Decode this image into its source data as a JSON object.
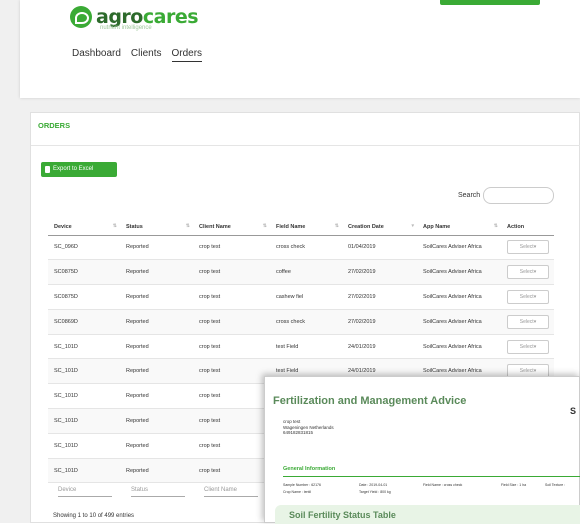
{
  "brand": {
    "name_part1": "agro",
    "name_part2": "cares",
    "tagline": "nutrient intelligence"
  },
  "nav": [
    "Dashboard",
    "Clients",
    "Orders"
  ],
  "panel": {
    "title": "ORDERS",
    "export_label": "Export to Excel",
    "search_label": "Search",
    "search_placeholder": ""
  },
  "table": {
    "headers": [
      "Device",
      "Status",
      "Client Name",
      "Field Name",
      "Creation Date",
      "App Name",
      "Action"
    ],
    "rows": [
      [
        "SC_096D",
        "Reported",
        "crop test",
        "cross check",
        "01/04/2019",
        "SoilCares Adviser Africa",
        "Select"
      ],
      [
        "SC0875D",
        "Reported",
        "crop test",
        "coffee",
        "27/02/2019",
        "SoilCares Adviser Africa",
        "Select"
      ],
      [
        "SC0875D",
        "Reported",
        "crop test",
        "cashew fiel",
        "27/02/2019",
        "SoilCares Adviser Africa",
        "Select"
      ],
      [
        "SC0869D",
        "Reported",
        "crop test",
        "cross check",
        "27/02/2019",
        "SoilCares Adviser Africa",
        "Select"
      ],
      [
        "SC_101D",
        "Reported",
        "crop test",
        "test Field",
        "24/01/2019",
        "SoilCares Adviser Africa",
        "Select"
      ],
      [
        "SC_101D",
        "Reported",
        "crop test",
        "test Field",
        "24/01/2019",
        "SoilCares Adviser Africa",
        "Select"
      ],
      [
        "SC_101D",
        "Reported",
        "crop test",
        "",
        "",
        "",
        ""
      ],
      [
        "SC_101D",
        "Reported",
        "crop test",
        "",
        "",
        "",
        ""
      ],
      [
        "SC_101D",
        "Reported",
        "crop test",
        "",
        "",
        "",
        ""
      ],
      [
        "SC_101D",
        "Reported",
        "crop test",
        "",
        "",
        "",
        ""
      ]
    ],
    "footer_filters": [
      "Device",
      "Status",
      "Client Name"
    ],
    "showing": "Showing 1 to 10 of 499 entries"
  },
  "report": {
    "title": "Fertilization and Management Advice",
    "right_initial": "S",
    "address": [
      "crop test",
      "Wageningen Netherlands",
      "649182831815"
    ],
    "section": "General Information",
    "sample_number": "Sample Number : 62176",
    "date": "Date : 2019-04-01",
    "field_name": "Field Name : cross check",
    "field_size": "Field Size : 1 ha",
    "soil_texture": "Soil Texture :",
    "crop_name": "Crop Name : lentil",
    "target_yield": "Target Yield : 800 kg",
    "table_title": "Soil Fertility Status Table"
  },
  "colors": {
    "accent": "#3aaa35",
    "dark_green": "#2d6a2b"
  }
}
